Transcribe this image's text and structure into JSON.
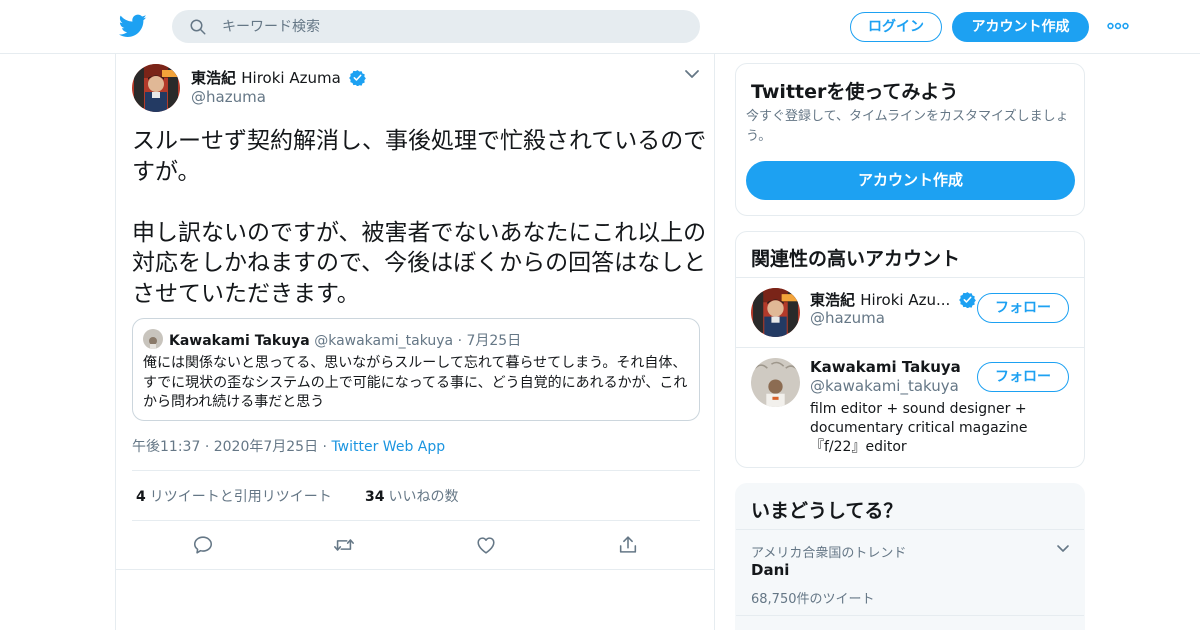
{
  "header": {
    "search_placeholder": "キーワード検索",
    "login_label": "ログイン",
    "signup_label": "アカウント作成"
  },
  "tweet": {
    "author_name_jp": "東浩紀",
    "author_name_latin": "Hiroki Azuma",
    "author_handle": "@hazuma",
    "text": "スルーせず契約解消し、事後処理で忙殺されているのですが。\n\n申し訳ないのですが、被害者でないあなたにこれ以上の対応をしかねますので、今後はぼくからの回答はなしとさせていただきます。",
    "quote": {
      "name": "Kawakami Takuya",
      "handle": "@kawakami_takuya",
      "date": "7月25日",
      "text": "俺には関係ないと思ってる、思いながらスルーして忘れて暮らせてしまう。それ自体、すでに現状の歪なシステムの上で可能になってる事に、どう自覚的にあれるかが、これから問われ続ける事だと思う"
    },
    "time": "午後11:37",
    "date": "2020年7月25日",
    "app": "Twitter Web App",
    "retweets_count": "4",
    "retweets_label": "リツイートと引用リツイート",
    "likes_count": "34",
    "likes_label": "いいねの数"
  },
  "sidebar": {
    "try_twitter": {
      "title": "Twitterを使ってみよう",
      "description": "今すぐ登録して、タイムラインをカスタマイズしましょう。",
      "button_label": "アカウント作成"
    },
    "related": {
      "title": "関連性の高いアカウント",
      "accounts": [
        {
          "name_jp": "東浩紀",
          "name_latin": "Hiroki Azu...",
          "handle": "@hazuma",
          "follow_label": "フォロー",
          "verified": true
        },
        {
          "name": "Kawakami Takuya",
          "handle": "@kawakami_takuya",
          "follow_label": "フォロー",
          "bio": "film editor + sound designer + documentary critical magazine『f/22』editor"
        }
      ]
    },
    "trends": {
      "title": "いまどうしてる？",
      "items": [
        {
          "context": "アメリカ合衆国のトレンド",
          "name": "Dani",
          "count": "68,750件のツイート"
        }
      ]
    }
  },
  "colors": {
    "accent": "#1da1f2",
    "text_primary": "#14171a",
    "text_secondary": "#657786",
    "border": "#e6ecf0"
  },
  "icons": [
    "twitter-logo-icon",
    "search-icon",
    "more-icon",
    "verified-icon",
    "chevron-down-icon",
    "reply-icon",
    "retweet-icon",
    "like-icon",
    "share-icon"
  ]
}
